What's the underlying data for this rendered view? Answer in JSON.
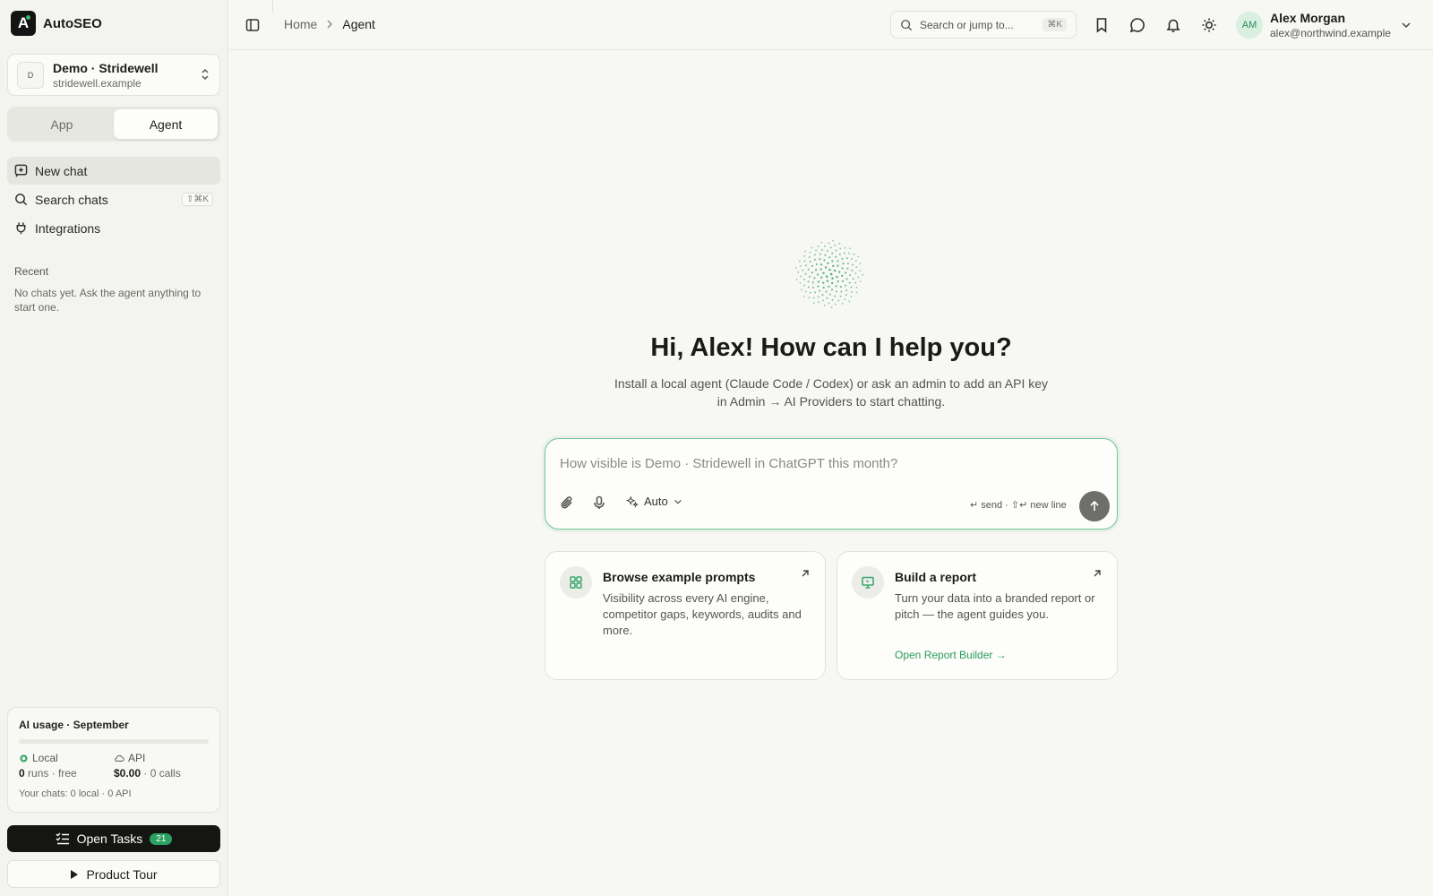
{
  "app": {
    "name": "AutoSEO"
  },
  "workspace": {
    "initial": "D",
    "name": "Demo · Stridewell",
    "domain": "stridewell.example"
  },
  "mode_tabs": [
    {
      "label": "App"
    },
    {
      "label": "Agent"
    }
  ],
  "nav": {
    "new_chat": "New chat",
    "search_chats": "Search chats",
    "search_chats_shortcut": "⇧⌘K",
    "integrations": "Integrations"
  },
  "recent": {
    "label": "Recent",
    "empty": "No chats yet. Ask the agent anything to start one."
  },
  "usage": {
    "title": "AI usage · September",
    "progress": 0,
    "local_label": "Local",
    "local_count": "0",
    "local_suffix": "runs · free",
    "api_label": "API",
    "api_cost": "$0.00",
    "api_suffix": "· 0 calls",
    "footer": "Your chats: 0 local · 0 API"
  },
  "tasks": {
    "label": "Open Tasks",
    "count": "21"
  },
  "tour": {
    "label": "Product Tour"
  },
  "breadcrumb": {
    "home": "Home",
    "current": "Agent"
  },
  "search": {
    "placeholder": "Search or jump to...",
    "shortcut": "⌘K"
  },
  "user": {
    "initials": "AM",
    "name": "Alex Morgan",
    "email": "alex@northwind.example"
  },
  "hero": {
    "greeting": "Hi, Alex! How can I help you?",
    "subtitle": "Install a local agent (Claude Code / Codex) or ask an admin to add an API key in Admin → AI Providers to start chatting."
  },
  "composer": {
    "placeholder": "How visible is Demo · Stridewell in ChatGPT this month?",
    "model": "Auto",
    "hint": "↵ send · ⇧↵ new line"
  },
  "cards": [
    {
      "title": "Browse example prompts",
      "desc": "Visibility across every AI engine, competitor gaps, keywords, audits and more.",
      "link": ""
    },
    {
      "title": "Build a report",
      "desc": "Turn your data into a branded report or pitch — the agent guides you.",
      "link": "Open Report Builder →"
    }
  ],
  "colors": {
    "accent": "#3aa86a",
    "dark": "#151513",
    "background": "#f7f7f4"
  }
}
